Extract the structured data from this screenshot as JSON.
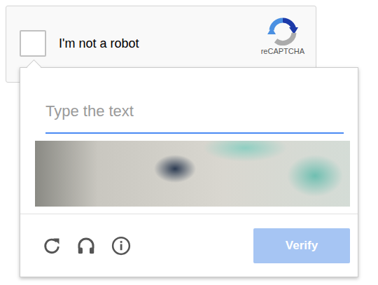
{
  "widget": {
    "label": "I'm not a robot",
    "checked": false,
    "brand": "reCAPTCHA"
  },
  "challenge": {
    "placeholder": "Type the text",
    "button": {
      "label": "Verify",
      "disabled": true
    }
  }
}
